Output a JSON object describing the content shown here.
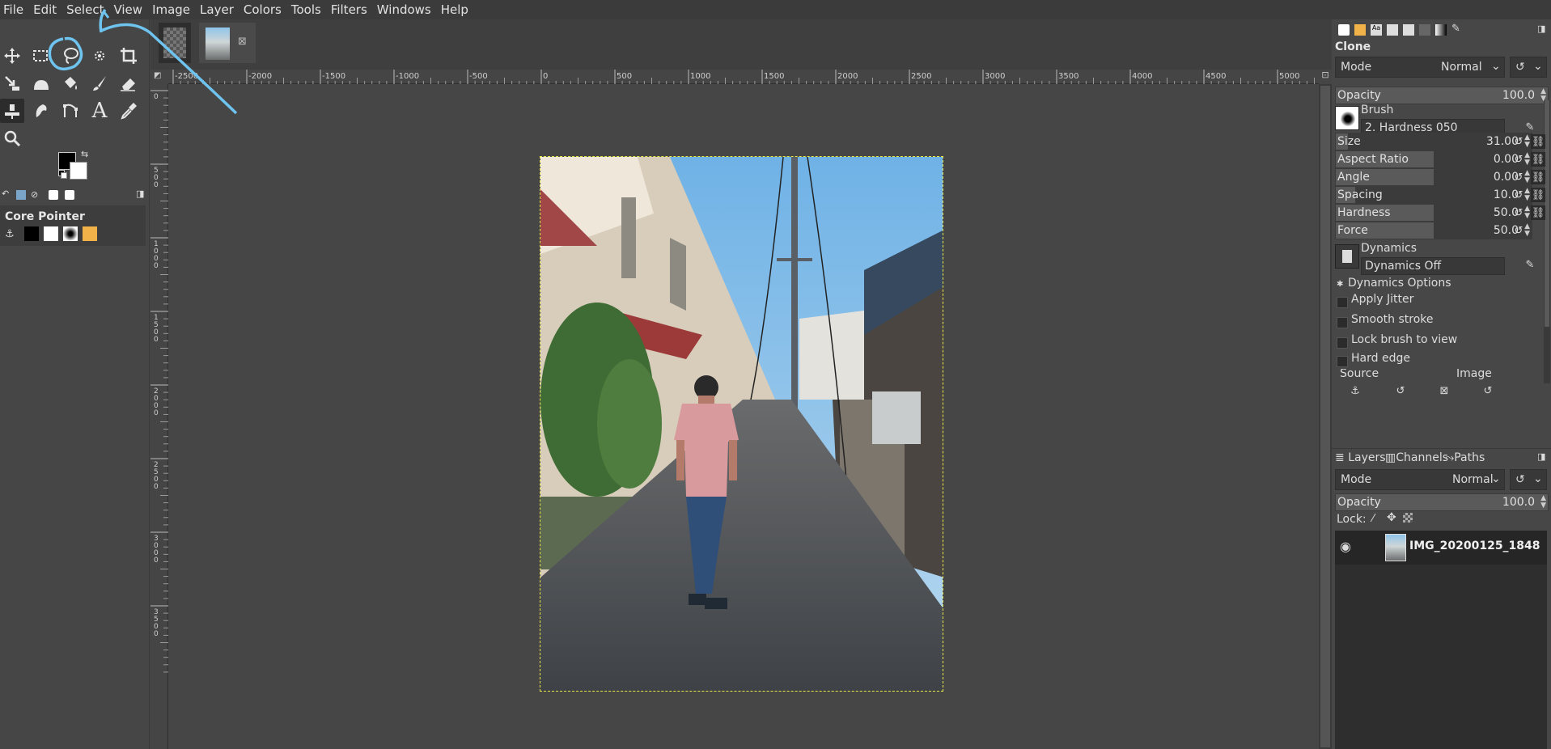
{
  "menu": [
    "File",
    "Edit",
    "Select",
    "View",
    "Image",
    "Layer",
    "Colors",
    "Tools",
    "Filters",
    "Windows",
    "Help"
  ],
  "toolbox": {
    "tools": [
      "move-tool-icon",
      "rect-select-icon",
      "free-select-lasso-icon",
      "fuzzy-select-icon",
      "crop-icon",
      "unified-transform-icon",
      "warp-transform-icon",
      "bucket-fill-icon",
      "paintbrush-icon",
      "eraser-icon",
      "clone-icon",
      "smudge-icon",
      "paths-icon",
      "text-icon",
      "color-picker-icon",
      "zoom-icon"
    ],
    "device_status": {
      "title": "Core Pointer"
    },
    "fg_color": "#000000",
    "bg_color": "#ffffff"
  },
  "rulers": {
    "horizontal": [
      "-2500",
      "-2000",
      "-1500",
      "-1000",
      "-500",
      "0",
      "500",
      "1000",
      "1500",
      "2000",
      "2500",
      "3000",
      "3500",
      "4000",
      "4500",
      "5000"
    ],
    "vertical": [
      "0",
      "5\n0\n0",
      "1\n0\n0\n0",
      "1\n5\n0\n0",
      "2\n0\n0\n0",
      "2\n5\n0\n0",
      "3\n0\n0\n0",
      "3\n5\n0\n0"
    ]
  },
  "tool_options": {
    "title": "Clone",
    "mode_label": "Mode",
    "mode_value": "Normal",
    "opacity_label": "Opacity",
    "opacity_value": "100.0",
    "brush_label": "Brush",
    "brush_value": "2. Hardness 050",
    "sliders": [
      {
        "label": "Size",
        "value": "31.00",
        "fraction": 0.06
      },
      {
        "label": "Aspect Ratio",
        "value": "0.00",
        "fraction": 0.5
      },
      {
        "label": "Angle",
        "value": "0.00",
        "fraction": 0.5
      },
      {
        "label": "Spacing",
        "value": "10.0",
        "fraction": 0.1
      },
      {
        "label": "Hardness",
        "value": "50.0",
        "fraction": 0.5
      },
      {
        "label": "Force",
        "value": "50.0",
        "fraction": 0.5
      }
    ],
    "dynamics_label": "Dynamics",
    "dynamics_value": "Dynamics Off",
    "dynamics_options": "Dynamics Options",
    "checkboxes": [
      "Apply Jitter",
      "Smooth stroke",
      "Lock brush to view",
      "Hard edge"
    ],
    "source_label": "Source",
    "source_value": "Image"
  },
  "layers_panel": {
    "tabs": [
      "Layers",
      "Channels",
      "Paths"
    ],
    "mode_label": "Mode",
    "mode_value": "Normal",
    "opacity_label": "Opacity",
    "opacity_value": "100.0",
    "lock_label": "Lock:",
    "layer_name": "IMG_20200125_1848"
  },
  "colors": {
    "annotation": "#6ec3ef",
    "sky": "#8fc4ea",
    "selection_border": "#e8e84a"
  }
}
